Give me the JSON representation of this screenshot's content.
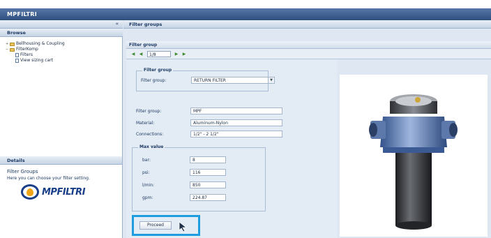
{
  "app": {
    "title": "MPFILTRI"
  },
  "browse": {
    "heading": "Browse",
    "collapse_icon": "«",
    "tree": [
      {
        "label": "Bellhousing & Coupling",
        "level": 0,
        "icon": "folder-icon"
      },
      {
        "label": "FilterKomp",
        "level": 0,
        "icon": "folder-icon"
      },
      {
        "label": "Filters",
        "level": 1,
        "icon": "page-icon"
      },
      {
        "label": "View sizing cart",
        "level": 1,
        "icon": "page-icon"
      }
    ]
  },
  "details": {
    "heading": "Details",
    "title": "Filter Groups",
    "text": "Here you can choose your filter setting.",
    "logo_text": "MPFILTRI"
  },
  "main": {
    "heading": "Filter groups",
    "group_header": "Filter group",
    "pager": {
      "page": "1/8"
    },
    "filter_group_fieldset": {
      "legend": "Filter group",
      "label": "Filter group:",
      "selected": "RETURN FILTER"
    },
    "fields": [
      {
        "label": "Filter group:",
        "value": "MPF"
      },
      {
        "label": "Material:",
        "value": "Aluminum-Nylon"
      },
      {
        "label": "Connections:",
        "value": "1/2\" - 2 1/2\""
      }
    ],
    "max_value": {
      "legend": "Max value",
      "rows": [
        {
          "label": "bar:",
          "value": "8"
        },
        {
          "label": "psi:",
          "value": "116"
        },
        {
          "label": "l/min:",
          "value": "850"
        },
        {
          "label": "gpm:",
          "value": "224.87"
        }
      ]
    },
    "proceed_label": "Proceed"
  },
  "colors": {
    "titlebar": "#2f4f7e",
    "highlight": "#1f9be0",
    "logo_blue": "#1a3f8a",
    "logo_orange": "#f0a418"
  }
}
